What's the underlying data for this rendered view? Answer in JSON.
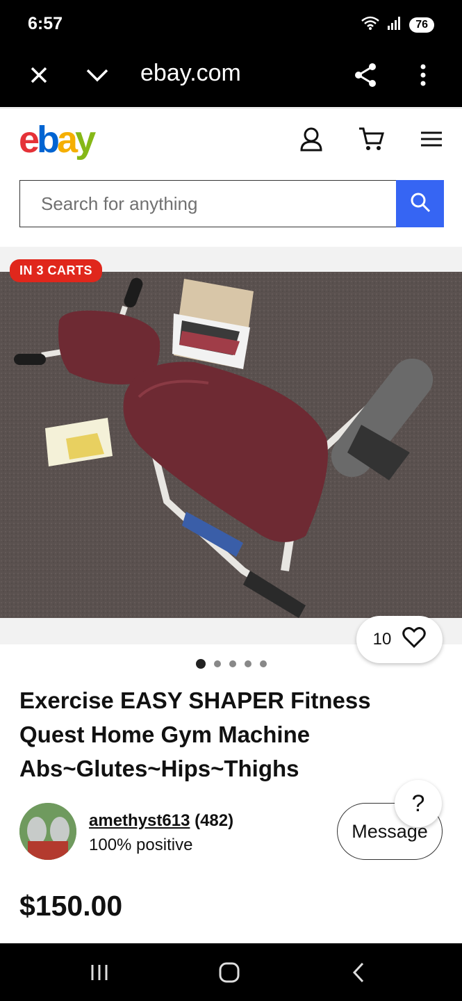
{
  "status": {
    "time": "6:57",
    "battery": "76"
  },
  "browser": {
    "url": "ebay.com"
  },
  "header": {
    "logo": {
      "e": "e",
      "b": "b",
      "a": "a",
      "y": "y"
    },
    "search_placeholder": "Search for anything"
  },
  "listing": {
    "badge": "IN 3 CARTS",
    "watch_count": "10",
    "image_count": 5,
    "active_image": 1,
    "title": "Exercise EASY SHAPER Fitness Quest Home Gym Machine Abs~Glutes~Hips~Thighs",
    "seller": {
      "name": "amethyst613",
      "feedback": "(482)",
      "positive": "100% positive"
    },
    "message_label": "Message",
    "help_label": "?",
    "price": "$150.00"
  },
  "colors": {
    "accent": "#3665f3",
    "badge": "#e0271c"
  }
}
